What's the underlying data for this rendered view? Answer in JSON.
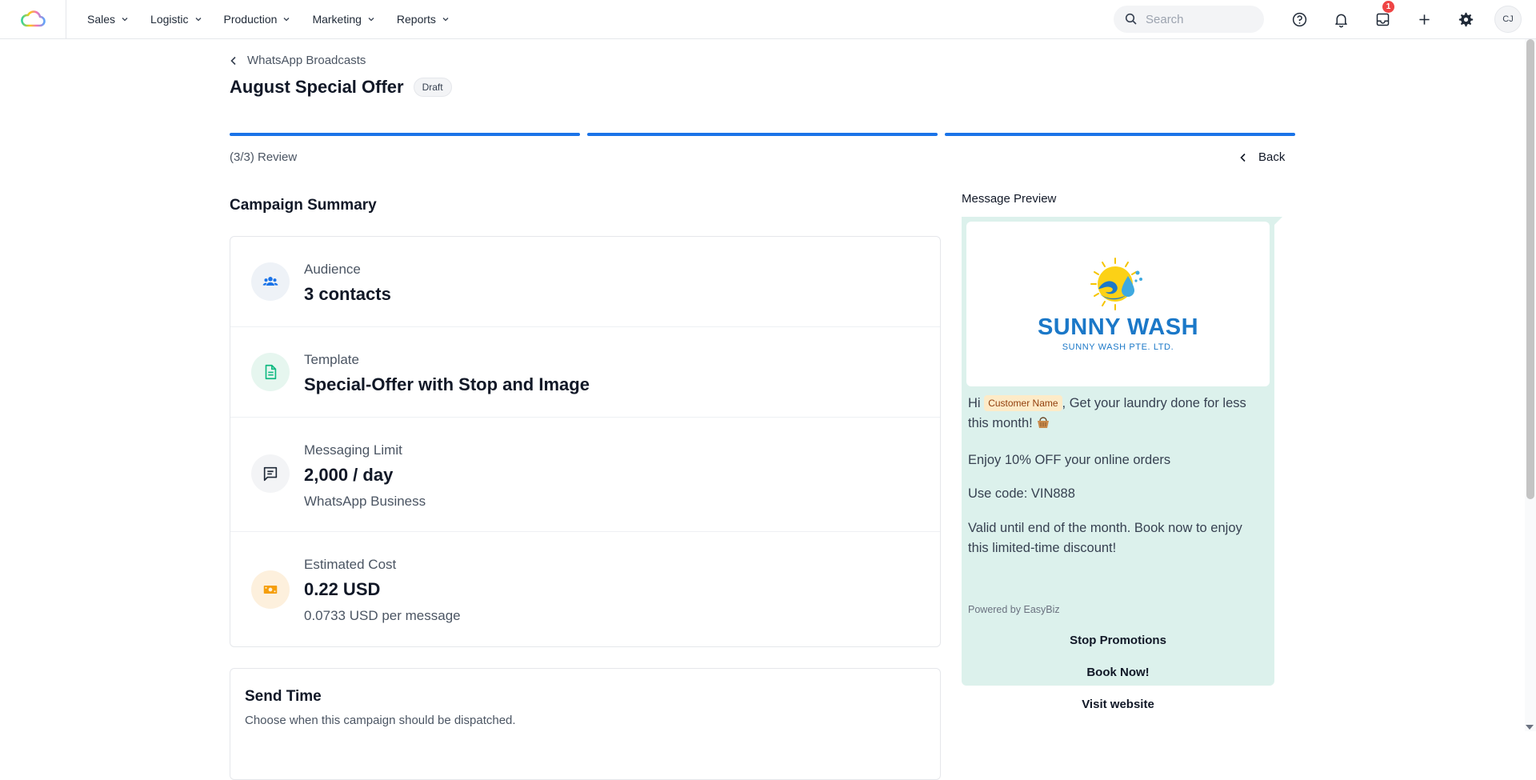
{
  "nav": {
    "items": [
      {
        "label": "Sales"
      },
      {
        "label": "Logistic"
      },
      {
        "label": "Production"
      },
      {
        "label": "Marketing"
      },
      {
        "label": "Reports"
      }
    ],
    "search_placeholder": "Search",
    "inbox_badge": "1",
    "avatar_initials": "CJ"
  },
  "header": {
    "breadcrumb": "WhatsApp Broadcasts",
    "title": "August Special Offer",
    "status": "Draft"
  },
  "wizard": {
    "step_label": "(3/3) Review",
    "back_label": "Back",
    "steps_total": 3,
    "steps_completed": 3
  },
  "summary": {
    "title": "Campaign Summary",
    "audience": {
      "label": "Audience",
      "value": "3 contacts",
      "icon": "users-icon"
    },
    "template": {
      "label": "Template",
      "value": "Special-Offer with Stop and Image",
      "icon": "document-icon"
    },
    "limit": {
      "label": "Messaging Limit",
      "value": "2,000 / day",
      "sub": "WhatsApp Business",
      "icon": "message-icon"
    },
    "cost": {
      "label": "Estimated Cost",
      "value": "0.22 USD",
      "sub": "0.0733 USD per message",
      "icon": "cash-icon"
    }
  },
  "send_time": {
    "title": "Send Time",
    "description": "Choose when this campaign should be dispatched."
  },
  "preview": {
    "title": "Message Preview",
    "brand_name": "SUNNY WASH",
    "brand_sub": "SUNNY WASH PTE. LTD.",
    "greeting": "Hi",
    "variable": "Customer Name",
    "line1": ", Get your laundry done for less this month!",
    "line2": "Enjoy 10% OFF your online orders",
    "line3": "Use code: VIN888",
    "line4": "Valid until end of the month. Book now to enjoy this limited-time discount!",
    "footer": "Powered by EasyBiz",
    "buttons": [
      "Stop Promotions",
      "Book Now!",
      "Visit website"
    ]
  },
  "colors": {
    "accent": "#1a73e8",
    "bubble": "#dcf1ec",
    "brand": "#1b78c8"
  }
}
